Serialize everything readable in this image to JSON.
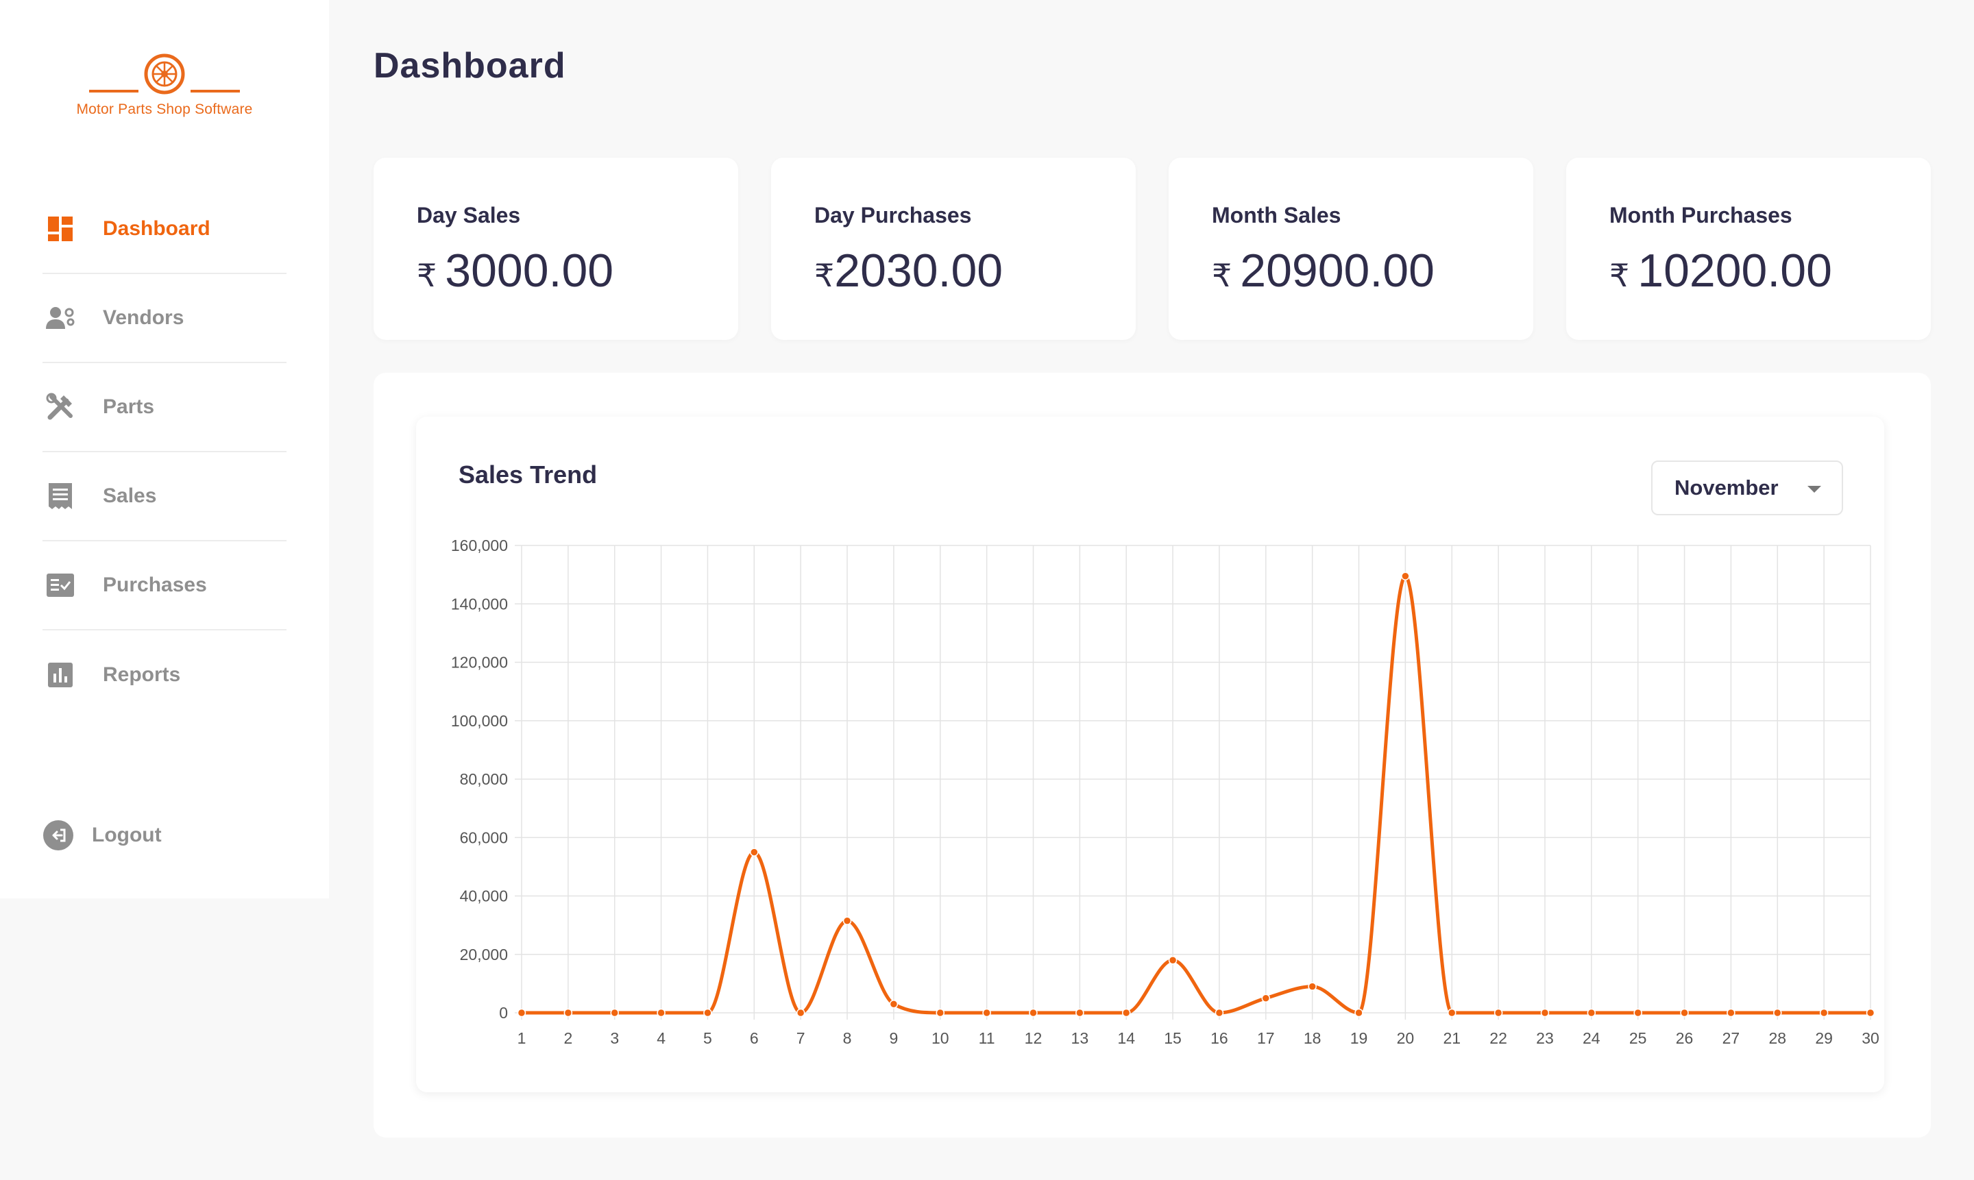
{
  "brand": {
    "name": "Motor Parts Shop Software",
    "color": "#f0650f"
  },
  "sidebar": {
    "items": [
      {
        "label": "Dashboard",
        "icon": "dashboard-icon",
        "active": true
      },
      {
        "label": "Vendors",
        "icon": "vendors-icon",
        "active": false
      },
      {
        "label": "Parts",
        "icon": "tools-icon",
        "active": false
      },
      {
        "label": "Sales",
        "icon": "receipt-icon",
        "active": false
      },
      {
        "label": "Purchases",
        "icon": "checklist-icon",
        "active": false
      },
      {
        "label": "Reports",
        "icon": "bar-chart-icon",
        "active": false
      }
    ],
    "logout_label": "Logout"
  },
  "header": {
    "title": "Dashboard"
  },
  "cards": [
    {
      "label": "Day Sales",
      "currency": "₹",
      "value": "3000.00"
    },
    {
      "label": "Day Purchases",
      "currency": "₹",
      "value": "2030.00"
    },
    {
      "label": "Month Sales",
      "currency": "₹",
      "value": "20900.00"
    },
    {
      "label": "Month Purchases",
      "currency": "₹",
      "value": "10200.00"
    }
  ],
  "sales_trend": {
    "title": "Sales Trend",
    "month_select": {
      "value": "November"
    }
  },
  "chart_data": {
    "type": "line",
    "title": "Sales Trend",
    "x": [
      1,
      2,
      3,
      4,
      5,
      6,
      7,
      8,
      9,
      10,
      11,
      12,
      13,
      14,
      15,
      16,
      17,
      18,
      19,
      20,
      21,
      22,
      23,
      24,
      25,
      26,
      27,
      28,
      29,
      30
    ],
    "values": [
      0,
      0,
      0,
      0,
      0,
      55000,
      0,
      31500,
      3000,
      0,
      0,
      0,
      0,
      0,
      18000,
      0,
      5000,
      9000,
      0,
      149500,
      0,
      0,
      0,
      0,
      0,
      0,
      0,
      0,
      0,
      0
    ],
    "ylim": [
      0,
      160000
    ],
    "yticks": [
      0,
      20000,
      40000,
      60000,
      80000,
      100000,
      120000,
      140000,
      160000
    ],
    "ytick_labels": [
      "0",
      "20,000",
      "40,000",
      "60,000",
      "80,000",
      "100,000",
      "120,000",
      "140,000",
      "160,000"
    ],
    "grid": true,
    "line_color": "#f0650f",
    "grid_color": "#e3e3e3",
    "xlabel": "",
    "ylabel": ""
  }
}
